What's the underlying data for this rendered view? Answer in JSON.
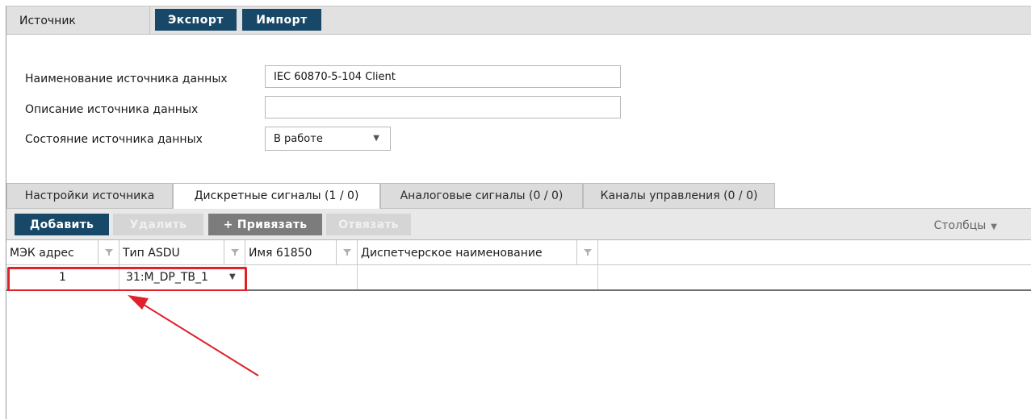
{
  "topbar": {
    "source_tab": "Источник",
    "export_label": "Экспорт",
    "import_label": "Импорт"
  },
  "form": {
    "name_label": "Наименование источника данных",
    "name_value": "IEC 60870-5-104 Client",
    "description_label": "Описание источника данных",
    "description_value": "",
    "state_label": "Состояние источника данных",
    "state_value": "В работе"
  },
  "tabs": [
    {
      "label": "Настройки источника"
    },
    {
      "label": "Дискретные сигналы (1 / 0)"
    },
    {
      "label": "Аналоговые сигналы (0 / 0)"
    },
    {
      "label": "Каналы управления (0 / 0)"
    }
  ],
  "grid_toolbar": {
    "add_label": "Добавить",
    "delete_label": "Удалить",
    "bind_label": "+ Привязать",
    "unbind_label": "Отвязать",
    "columns_label": "Столбцы"
  },
  "table": {
    "columns": [
      "МЭК адрес",
      "Тип ASDU",
      "Имя 61850",
      "Диспетчерское наименование"
    ],
    "rows": [
      {
        "address": "1",
        "asdu_type": "31:M_DP_TB_1",
        "name61850": "",
        "dispatch_name": ""
      }
    ]
  },
  "colors": {
    "primary_button": "#184868",
    "highlight": "#e0202a",
    "annotation_arrow": "#e0202a"
  },
  "icons": {
    "filter": "filter-icon",
    "dropdown": "caret-down-icon"
  }
}
